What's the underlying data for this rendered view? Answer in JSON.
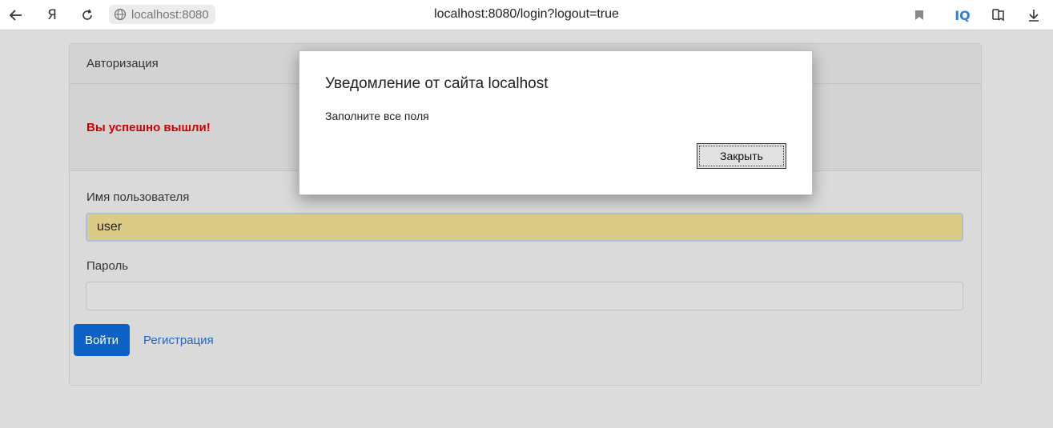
{
  "browser": {
    "site_chip": "localhost:8080",
    "url": "localhost:8080/login?logout=true",
    "iq_label": "IQ",
    "icons": [
      "back-arrow-icon",
      "yandex-logo-icon",
      "reload-icon",
      "globe-icon",
      "bookmark-icon",
      "iq-icon",
      "collections-icon",
      "download-icon"
    ]
  },
  "card": {
    "header": "Авторизация",
    "alert": "Вы успешно вышли!",
    "username_label": "Имя пользователя",
    "username_value": "user",
    "password_label": "Пароль",
    "password_value": "",
    "login_button": "Войти",
    "register_link": "Регистрация"
  },
  "dialog": {
    "title": "Уведомление от сайта localhost",
    "message": "Заполните все поля",
    "close_button": "Закрыть"
  },
  "colors": {
    "alert_text": "#d10000",
    "primary_button": "#0b62c4",
    "link": "#1f64c6",
    "autofill_bg": "#dccb85"
  }
}
